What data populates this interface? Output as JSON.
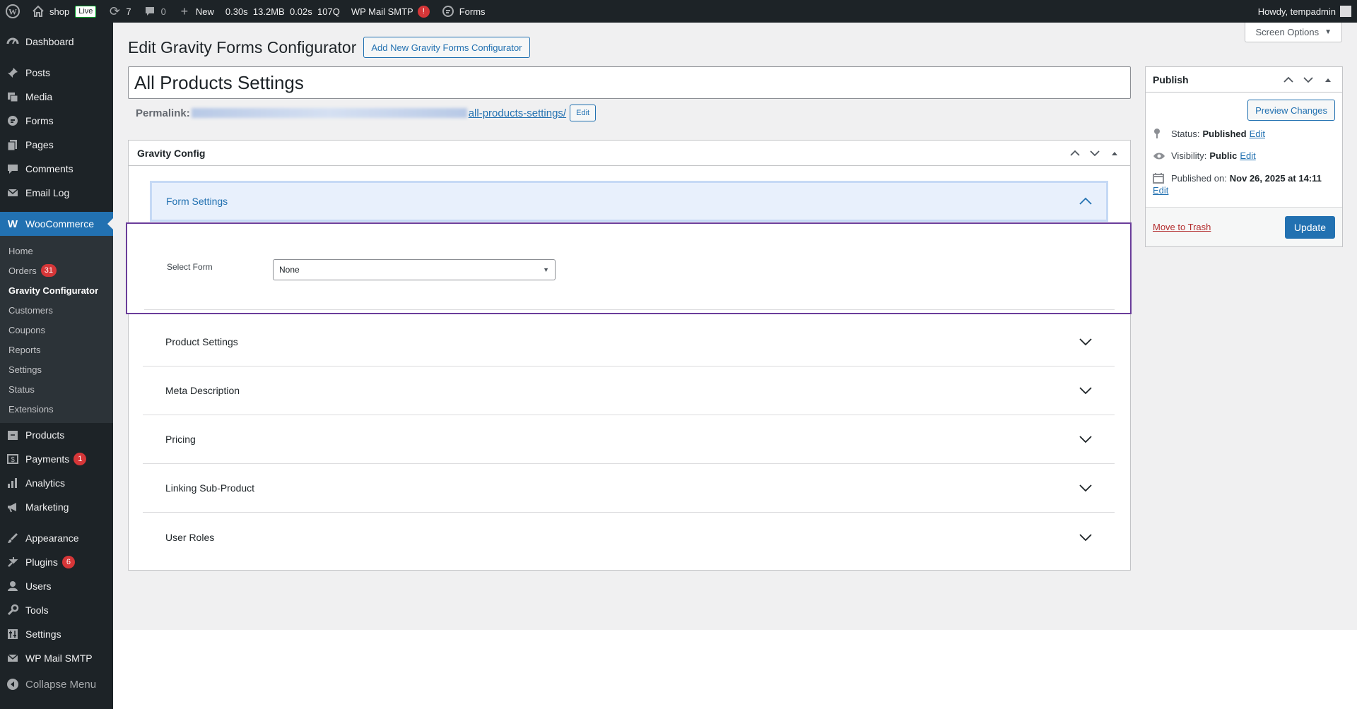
{
  "adminbar": {
    "site_name": "shop",
    "live_label": "Live",
    "updates_count": "7",
    "comments_count": "0",
    "new_label": "New",
    "perf": [
      "0.30s",
      "13.2MB",
      "0.02s",
      "107Q"
    ],
    "smtp_label": "WP Mail SMTP",
    "smtp_badge": "!",
    "forms_label": "Forms",
    "howdy": "Howdy, tempadmin"
  },
  "sidebar": {
    "items": [
      {
        "label": "Dashboard",
        "icon": "dashboard-icon"
      },
      {
        "label": "Posts",
        "icon": "pin-icon"
      },
      {
        "label": "Media",
        "icon": "media-icon"
      },
      {
        "label": "Forms",
        "icon": "forms-icon"
      },
      {
        "label": "Pages",
        "icon": "pages-icon"
      },
      {
        "label": "Comments",
        "icon": "comments-icon"
      },
      {
        "label": "Email Log",
        "icon": "email-icon"
      },
      {
        "label": "WooCommerce",
        "icon": "woocommerce-icon"
      },
      {
        "label": "Products",
        "icon": "products-icon"
      },
      {
        "label": "Payments",
        "icon": "payments-icon",
        "badge": "1"
      },
      {
        "label": "Analytics",
        "icon": "analytics-icon"
      },
      {
        "label": "Marketing",
        "icon": "marketing-icon"
      },
      {
        "label": "Appearance",
        "icon": "appearance-icon"
      },
      {
        "label": "Plugins",
        "icon": "plugins-icon",
        "badge": "6"
      },
      {
        "label": "Users",
        "icon": "users-icon"
      },
      {
        "label": "Tools",
        "icon": "tools-icon"
      },
      {
        "label": "Settings",
        "icon": "settings-icon"
      },
      {
        "label": "WP Mail SMTP",
        "icon": "mail-smtp-icon"
      },
      {
        "label": "Collapse Menu",
        "icon": "collapse-icon"
      }
    ],
    "woo_submenu": [
      {
        "label": "Home"
      },
      {
        "label": "Orders",
        "badge": "31"
      },
      {
        "label": "Gravity Configurator"
      },
      {
        "label": "Customers"
      },
      {
        "label": "Coupons"
      },
      {
        "label": "Reports"
      },
      {
        "label": "Settings"
      },
      {
        "label": "Status"
      },
      {
        "label": "Extensions"
      }
    ]
  },
  "screen_options": "Screen Options",
  "page": {
    "title": "Edit Gravity Forms Configurator",
    "add_new": "Add New Gravity Forms Configurator",
    "post_title": "All Products Settings",
    "permalink_label": "Permalink:",
    "permalink_slug": "all-products-settings/",
    "permalink_edit": "Edit"
  },
  "gravity_config": {
    "heading": "Gravity Config",
    "form_settings": "Form Settings",
    "select_form_label": "Select Form",
    "select_form_value": "None",
    "sections": [
      "Product Settings",
      "Meta Description",
      "Pricing",
      "Linking Sub-Product",
      "User Roles"
    ]
  },
  "publish": {
    "heading": "Publish",
    "preview": "Preview Changes",
    "status_label": "Status:",
    "status_value": "Published",
    "visibility_label": "Visibility:",
    "visibility_value": "Public",
    "published_label": "Published on:",
    "published_value": "Nov 26, 2025 at 14:11",
    "edit": "Edit",
    "trash": "Move to Trash",
    "update": "Update"
  },
  "colors": {
    "accent": "#2271b1",
    "sidebar": "#1d2327",
    "badge": "#d63638",
    "highlight_border": "#6a3d9a"
  }
}
